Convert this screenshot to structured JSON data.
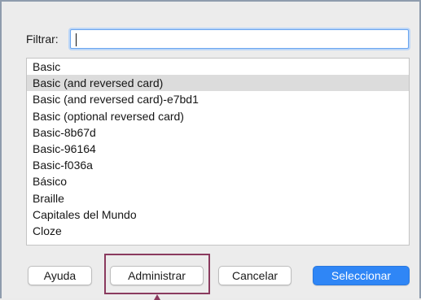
{
  "filter": {
    "label": "Filtrar:",
    "value": ""
  },
  "list": {
    "items": [
      {
        "label": "Basic",
        "selected": false
      },
      {
        "label": "Basic (and reversed card)",
        "selected": true
      },
      {
        "label": "Basic (and reversed card)-e7bd1",
        "selected": false
      },
      {
        "label": "Basic (optional reversed card)",
        "selected": false
      },
      {
        "label": "Basic-8b67d",
        "selected": false
      },
      {
        "label": "Basic-96164",
        "selected": false
      },
      {
        "label": "Basic-f036a",
        "selected": false
      },
      {
        "label": "Básico",
        "selected": false
      },
      {
        "label": "Braille",
        "selected": false
      },
      {
        "label": "Capitales del Mundo",
        "selected": false
      },
      {
        "label": "Cloze",
        "selected": false
      }
    ]
  },
  "buttons": {
    "help": "Ayuda",
    "manage": "Administrar",
    "cancel": "Cancelar",
    "select": "Seleccionar"
  },
  "colors": {
    "accent": "#2f86f6",
    "selection": "#dcdcdc",
    "highlight": "#8a3a5e"
  }
}
